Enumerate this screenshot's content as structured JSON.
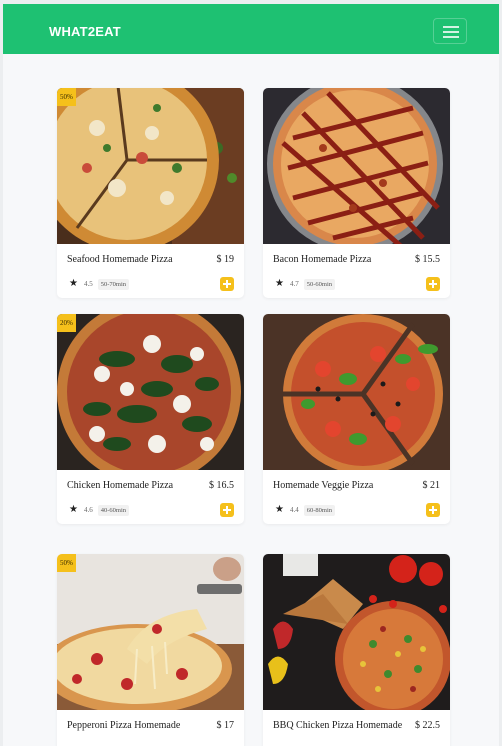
{
  "brand": "WHAT2EAT",
  "colors": {
    "nav": "#1ec172",
    "accent": "#f5c01b",
    "background": "#f7f8fa"
  },
  "icons": {
    "menu": "hamburger-menu-icon",
    "rating": "star-icon",
    "add": "plus-square-icon"
  },
  "products": [
    {
      "name": "Seafood Homemade Pizza",
      "price": "$ 19",
      "rating": "4.5",
      "time": "50-70min",
      "discount": "50%"
    },
    {
      "name": "Bacon Homemade Pizza",
      "price": "$ 15.5",
      "rating": "4.7",
      "time": "50-60min",
      "discount": ""
    },
    {
      "name": "Chicken Homemade Pizza",
      "price": "$ 16.5",
      "rating": "4.6",
      "time": "40-60min",
      "discount": "20%"
    },
    {
      "name": "Homemade Veggie Pizza",
      "price": "$ 21",
      "rating": "4.4",
      "time": "60-80min",
      "discount": ""
    },
    {
      "name": "Pepperoni Pizza Homemade",
      "price": "$ 17",
      "rating": "",
      "time": "",
      "discount": "50%"
    },
    {
      "name": "BBQ Chicken Pizza Homemade",
      "price": "$ 22.5",
      "rating": "",
      "time": "",
      "discount": ""
    }
  ]
}
